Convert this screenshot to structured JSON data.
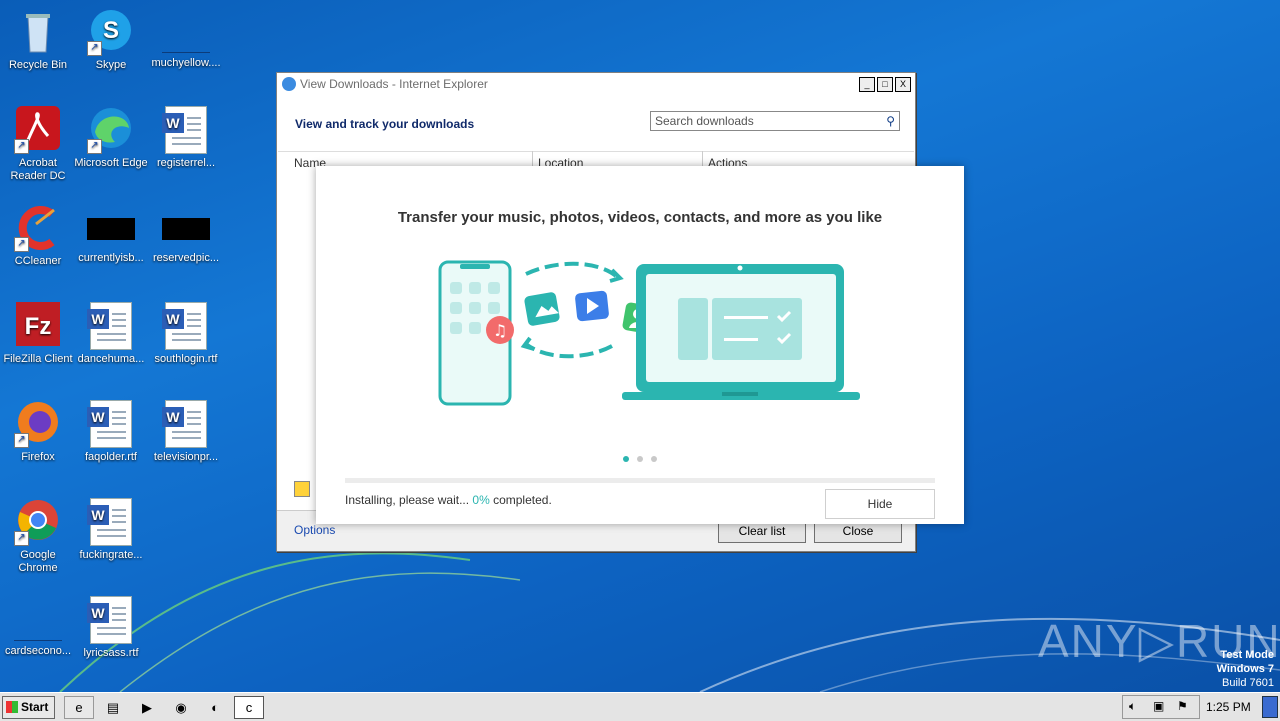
{
  "desktop": {
    "icons": [
      {
        "label": "Recycle Bin"
      },
      {
        "label": "Skype"
      },
      {
        "label": "muchyellow...."
      },
      {
        "label": "Acrobat Reader DC"
      },
      {
        "label": "Microsoft Edge"
      },
      {
        "label": "registerrel..."
      },
      {
        "label": "CCleaner"
      },
      {
        "label": "currentlyisb..."
      },
      {
        "label": "reservedpic..."
      },
      {
        "label": "FileZilla Client"
      },
      {
        "label": "dancehuma..."
      },
      {
        "label": "southlogin.rtf"
      },
      {
        "label": "Firefox"
      },
      {
        "label": "faqolder.rtf"
      },
      {
        "label": "televisionpr..."
      },
      {
        "label": "Google Chrome"
      },
      {
        "label": "fuckingrate..."
      },
      {
        "label": "cardsecono..."
      },
      {
        "label": "lyricsass.rtf"
      }
    ]
  },
  "ie_window": {
    "title": "View Downloads - Internet Explorer",
    "heading": "View and track your downloads",
    "search_placeholder": "Search downloads",
    "columns": [
      "Name",
      "Location",
      "Actions"
    ],
    "options_link": "Options",
    "clear_list": "Clear list",
    "close": "Close",
    "minimize": "_",
    "maximize": "□",
    "close_x": "X"
  },
  "installer": {
    "headline": "Transfer your music, photos, videos, contacts, and more as you like",
    "status_prefix": "Installing, please wait... ",
    "percent": "0%",
    "status_suffix": " completed.",
    "progress_fraction": 0,
    "hide_label": "Hide",
    "carousel_total": 3,
    "carousel_active": 1,
    "accent_color": "#2bb5b0"
  },
  "taskbar": {
    "start_label": "Start",
    "clock": "1:25 PM"
  },
  "watermark": {
    "text": "ANY▷RUN",
    "test_mode": "Test Mode",
    "os": "Windows 7",
    "build": "Build 7601"
  }
}
